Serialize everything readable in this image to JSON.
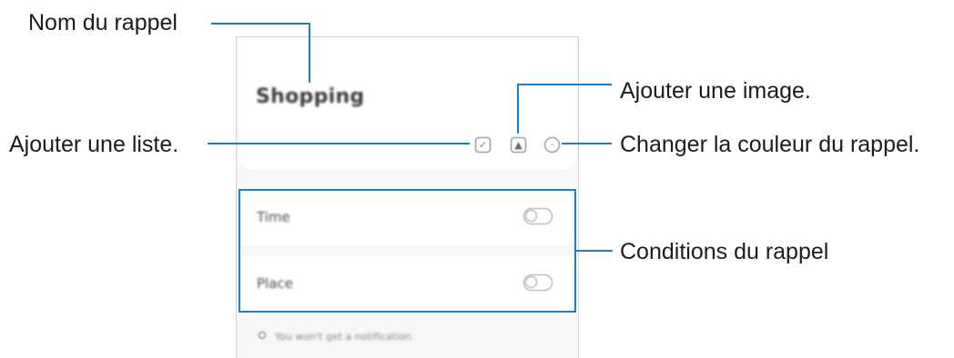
{
  "callouts": {
    "reminder_name": "Nom du rappel",
    "add_image": "Ajouter une image.",
    "add_list": "Ajouter une liste.",
    "change_color": "Changer la couleur du rappel.",
    "conditions": "Conditions du rappel"
  },
  "note": {
    "title": "Shopping"
  },
  "toolbar": {
    "list_icon": "checkbox-icon",
    "image_icon": "image-icon",
    "color_icon": "palette-icon"
  },
  "conditions": {
    "time_label": "Time",
    "place_label": "Place"
  },
  "footer": {
    "info_text": "You won't get a notification."
  },
  "colors": {
    "accent": "#1f7fc5"
  }
}
